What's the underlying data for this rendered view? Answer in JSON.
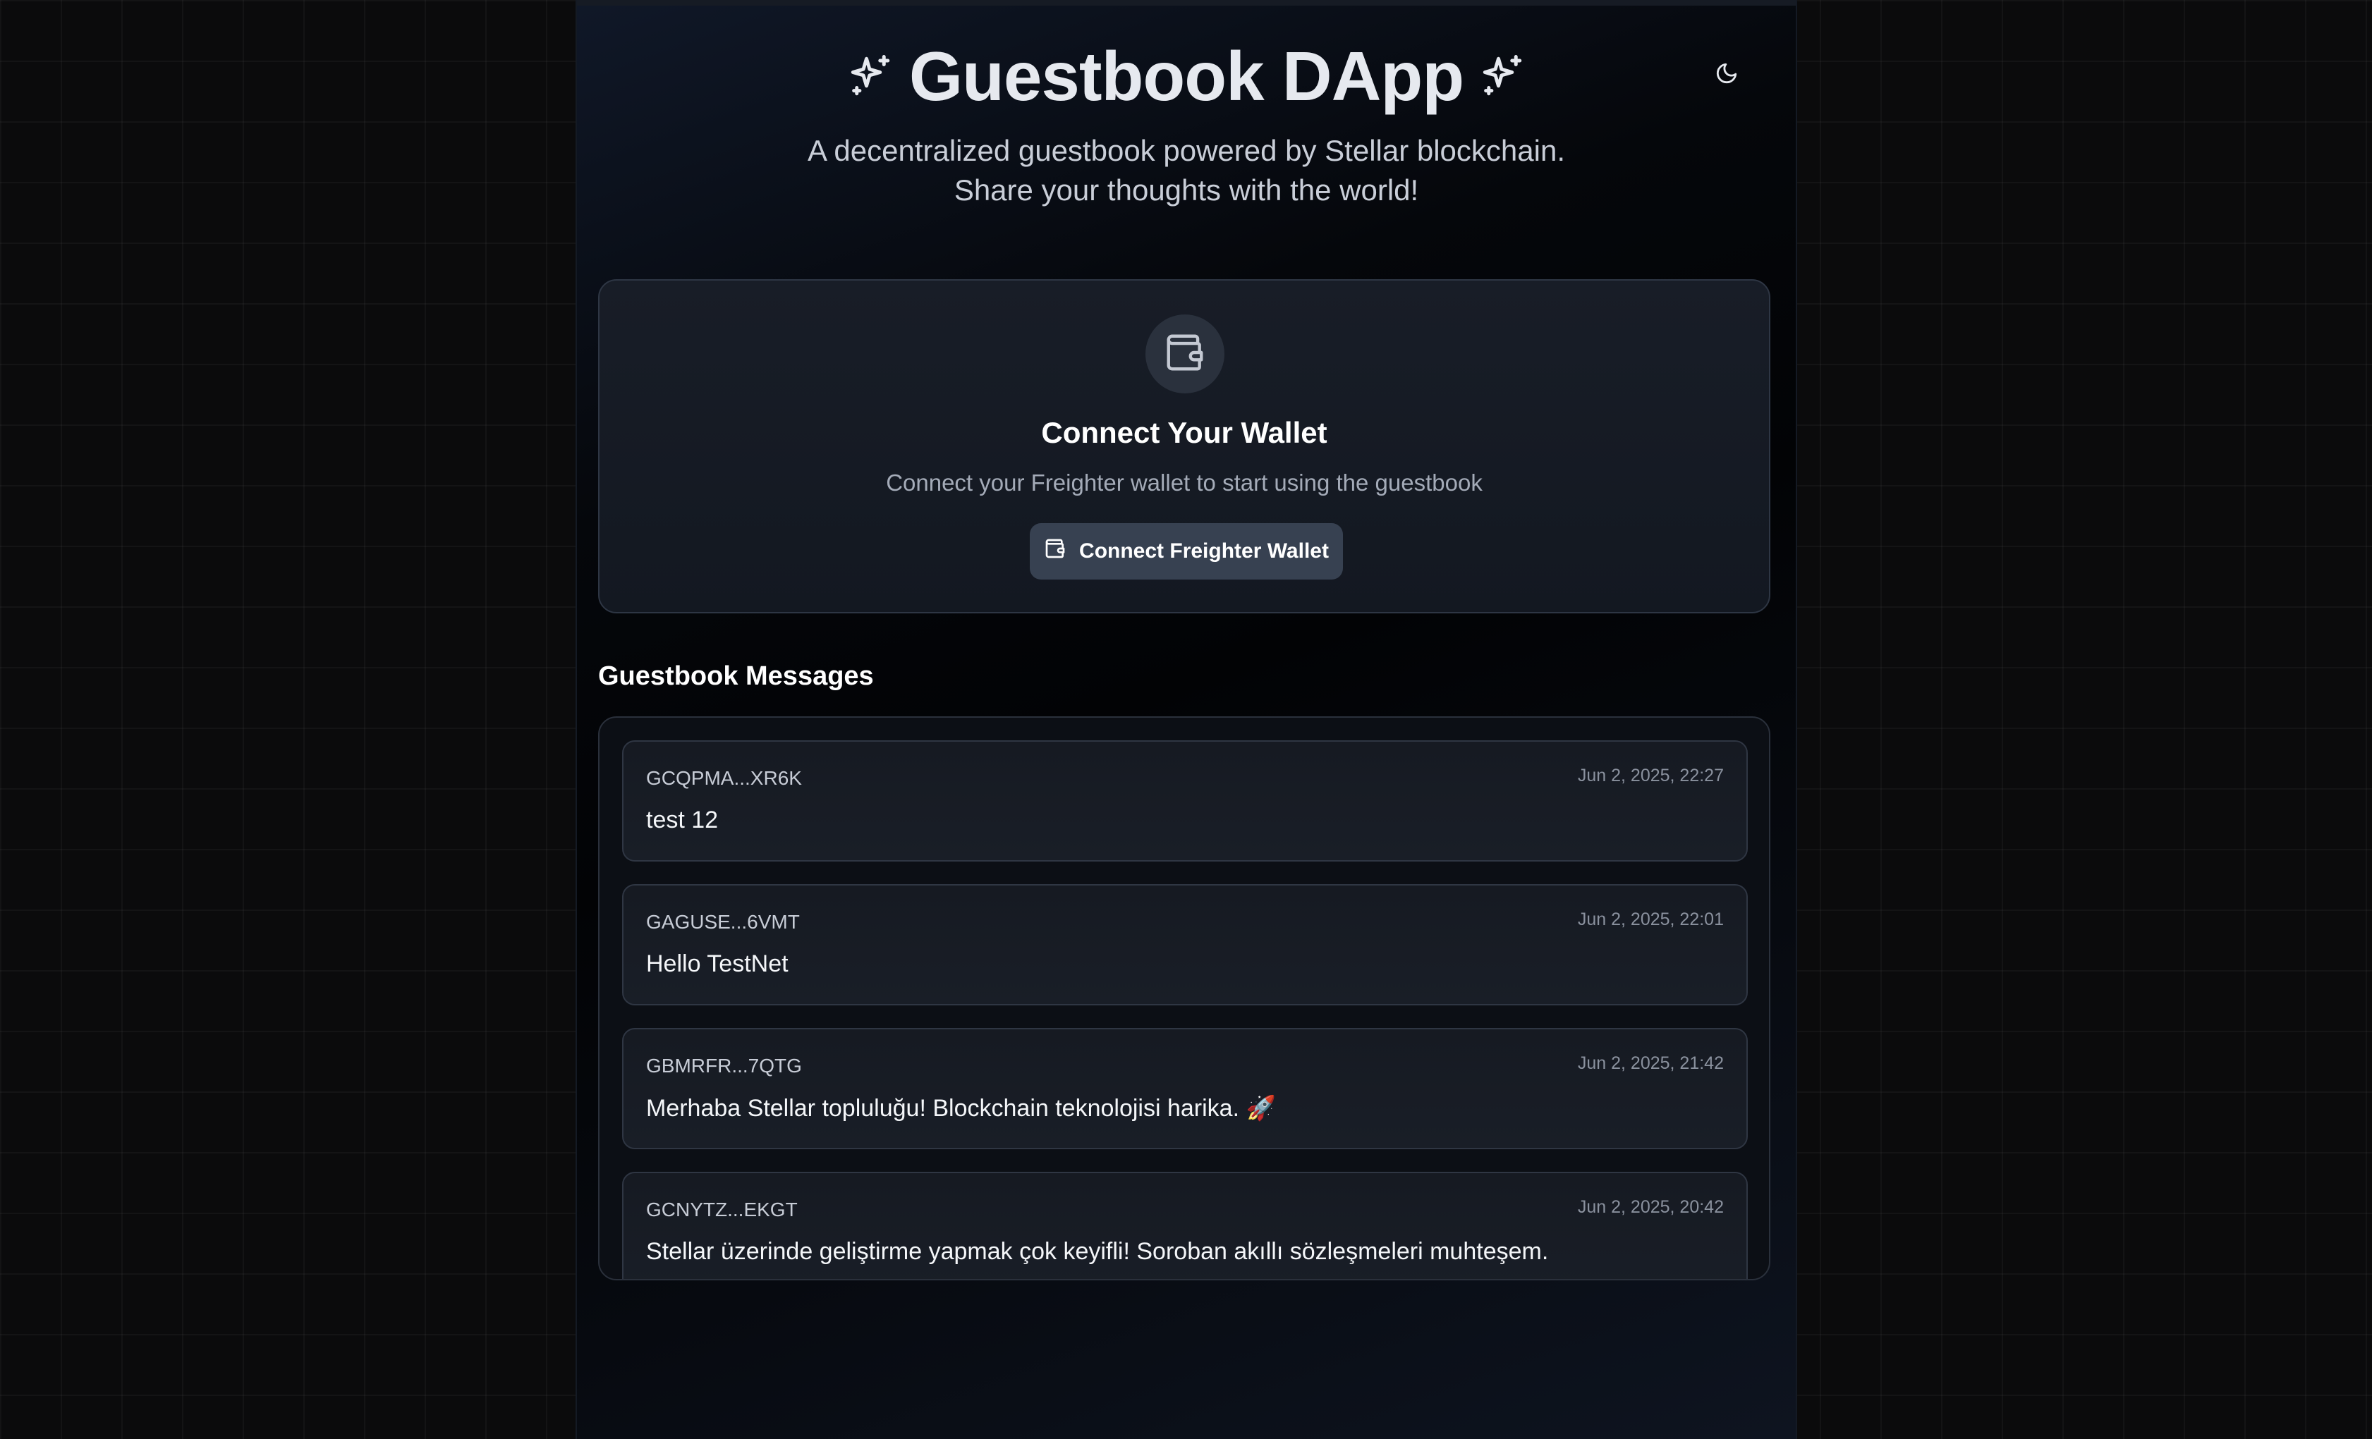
{
  "header": {
    "title": "Guestbook DApp",
    "subtitle": "A decentralized guestbook powered by Stellar blockchain. Share your thoughts with the world!",
    "left_icon": "sparkles-icon",
    "right_icon": "sparkles-icon",
    "theme_toggle_icon": "moon-icon"
  },
  "wallet": {
    "icon": "wallet-icon",
    "heading": "Connect Your Wallet",
    "description": "Connect your Freighter wallet to start using the guestbook",
    "button_label": "Connect Freighter Wallet",
    "button_icon": "wallet-icon"
  },
  "messages": {
    "heading": "Guestbook Messages",
    "items": [
      {
        "address": "GCQPMA...XR6K",
        "time": "Jun 2, 2025, 22:27",
        "text": "test 12"
      },
      {
        "address": "GAGUSE...6VMT",
        "time": "Jun 2, 2025, 22:01",
        "text": "Hello TestNet"
      },
      {
        "address": "GBMRFR...7QTG",
        "time": "Jun 2, 2025, 21:42",
        "text": "Merhaba Stellar topluluğu! Blockchain teknolojisi harika. 🚀"
      },
      {
        "address": "GCNYTZ...EKGT",
        "time": "Jun 2, 2025, 20:42",
        "text": "Stellar üzerinde geliştirme yapmak çok keyifli! Soroban akıllı sözleşmeleri muhteşem."
      }
    ]
  },
  "colors": {
    "background": "#0b0b0c",
    "card": "#181d27",
    "button": "#374151",
    "border": "#2e3644"
  }
}
